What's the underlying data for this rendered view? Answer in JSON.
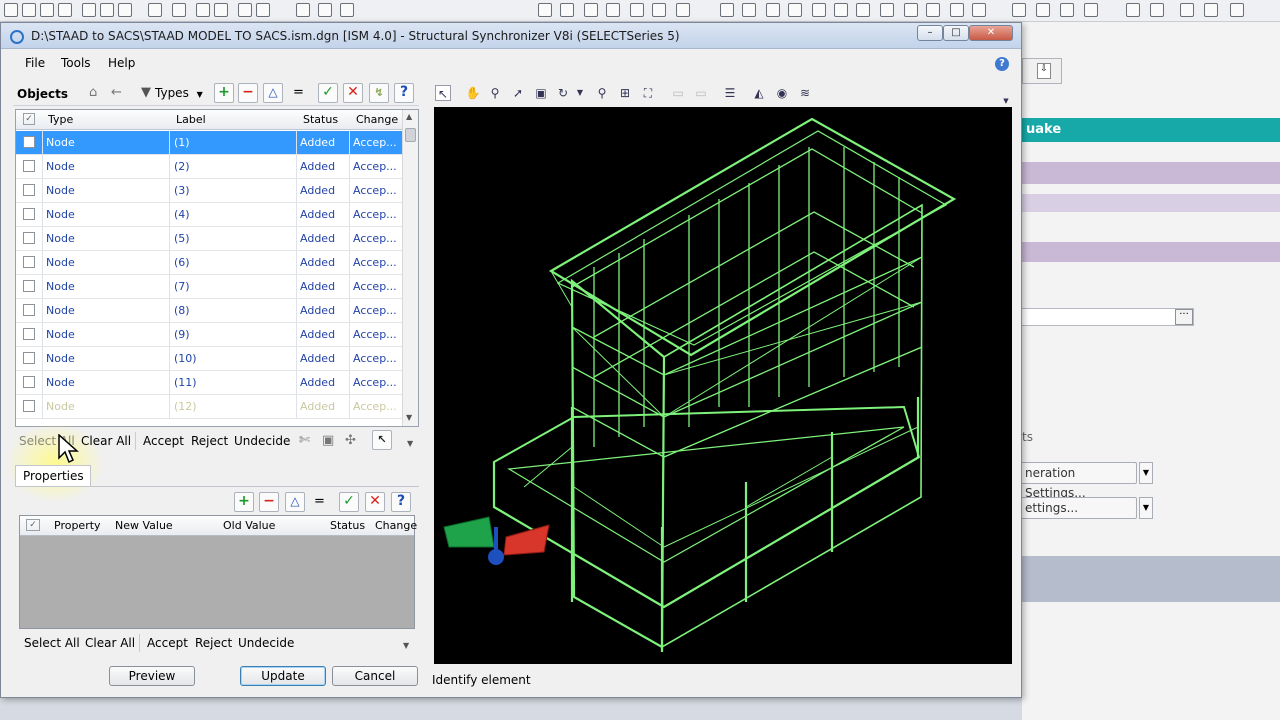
{
  "window": {
    "title": "D:\\STAAD to SACS\\STAAD MODEL TO SACS.ism.dgn [ISM 4.0] - Structural Synchronizer V8i (SELECTSeries 5)",
    "controls": {
      "minimize": "–",
      "maximize": "□",
      "close": "✕"
    }
  },
  "menu": [
    "File",
    "Tools",
    "Help"
  ],
  "objects": {
    "title": "Objects",
    "types_label": "Types",
    "columns": [
      "Type",
      "Label",
      "Status",
      "Change"
    ],
    "rows": [
      {
        "type": "Node",
        "label": "(1)",
        "status": "Added",
        "change": "Accep..."
      },
      {
        "type": "Node",
        "label": "(2)",
        "status": "Added",
        "change": "Accep..."
      },
      {
        "type": "Node",
        "label": "(3)",
        "status": "Added",
        "change": "Accep..."
      },
      {
        "type": "Node",
        "label": "(4)",
        "status": "Added",
        "change": "Accep..."
      },
      {
        "type": "Node",
        "label": "(5)",
        "status": "Added",
        "change": "Accep..."
      },
      {
        "type": "Node",
        "label": "(6)",
        "status": "Added",
        "change": "Accep..."
      },
      {
        "type": "Node",
        "label": "(7)",
        "status": "Added",
        "change": "Accep..."
      },
      {
        "type": "Node",
        "label": "(8)",
        "status": "Added",
        "change": "Accep..."
      },
      {
        "type": "Node",
        "label": "(9)",
        "status": "Added",
        "change": "Accep..."
      },
      {
        "type": "Node",
        "label": "(10)",
        "status": "Added",
        "change": "Accep..."
      },
      {
        "type": "Node",
        "label": "(11)",
        "status": "Added",
        "change": "Accep..."
      },
      {
        "type": "Node",
        "label": "(12)",
        "status": "Added",
        "change": "Accep..."
      }
    ],
    "actions": {
      "select_all": "Select All",
      "clear_all": "Clear All",
      "accept": "Accept",
      "reject": "Reject",
      "undecide": "Undecide"
    }
  },
  "properties": {
    "tab": "Properties",
    "columns": [
      "Property",
      "New Value",
      "Old Value",
      "Status",
      "Change"
    ],
    "actions": {
      "select_all": "Select All",
      "clear_all": "Clear All",
      "accept": "Accept",
      "reject": "Reject",
      "undecide": "Undecide"
    }
  },
  "buttons": {
    "preview": "Preview",
    "update": "Update",
    "cancel": "Cancel"
  },
  "status": "Identify element",
  "background": {
    "section_title": "uake",
    "settings_1": "neration Settings...",
    "settings_2": "ettings...",
    "partial": "ts"
  },
  "colors": {
    "selection": "#3399ff",
    "model_green": "#7ef27a",
    "teal": "#16a9a8",
    "axis_y": "#1fa34a",
    "axis_x": "#d9362b",
    "axis_z": "#1d4fbf"
  }
}
